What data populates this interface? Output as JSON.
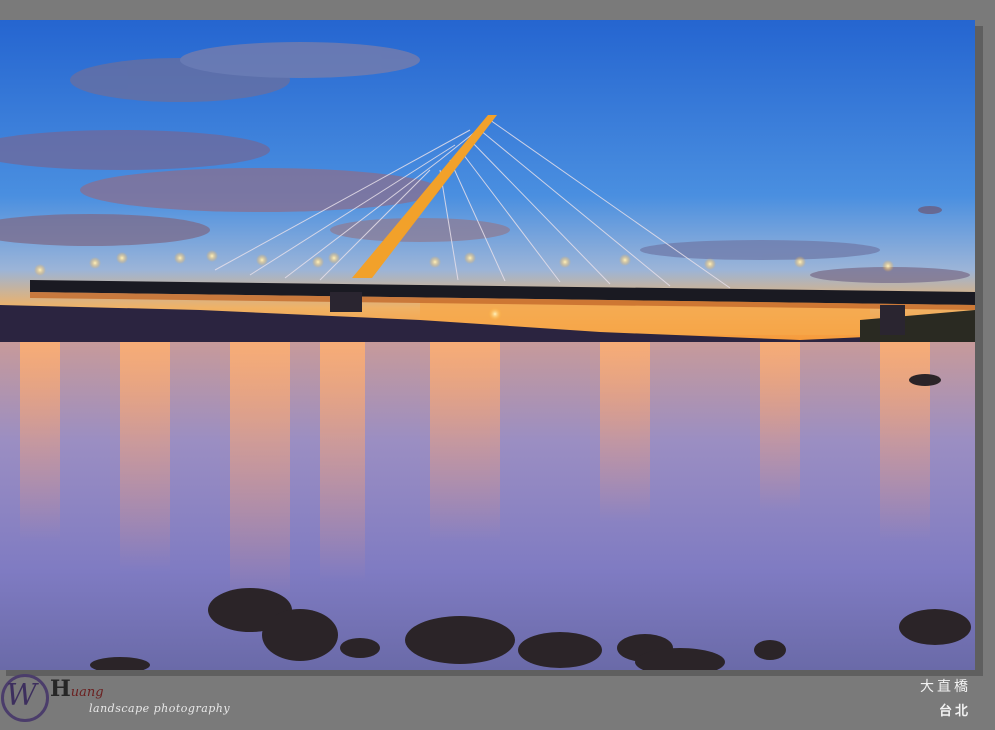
{
  "photo": {
    "subject": "cable-stayed-bridge-dusk",
    "colors": {
      "sky_top": "#2a6fd6",
      "sky_mid": "#3e86e0",
      "horizon": "#f6a74a",
      "water": "#8d7ec0",
      "pylon": "#f0a22a",
      "frame": "#7a7a7a"
    }
  },
  "watermark": {
    "initial": "W",
    "mark_letters": "H",
    "mark_sub": "uang",
    "tagline": "landscape photography"
  },
  "caption": {
    "name": "大直橋",
    "location": "台北"
  }
}
